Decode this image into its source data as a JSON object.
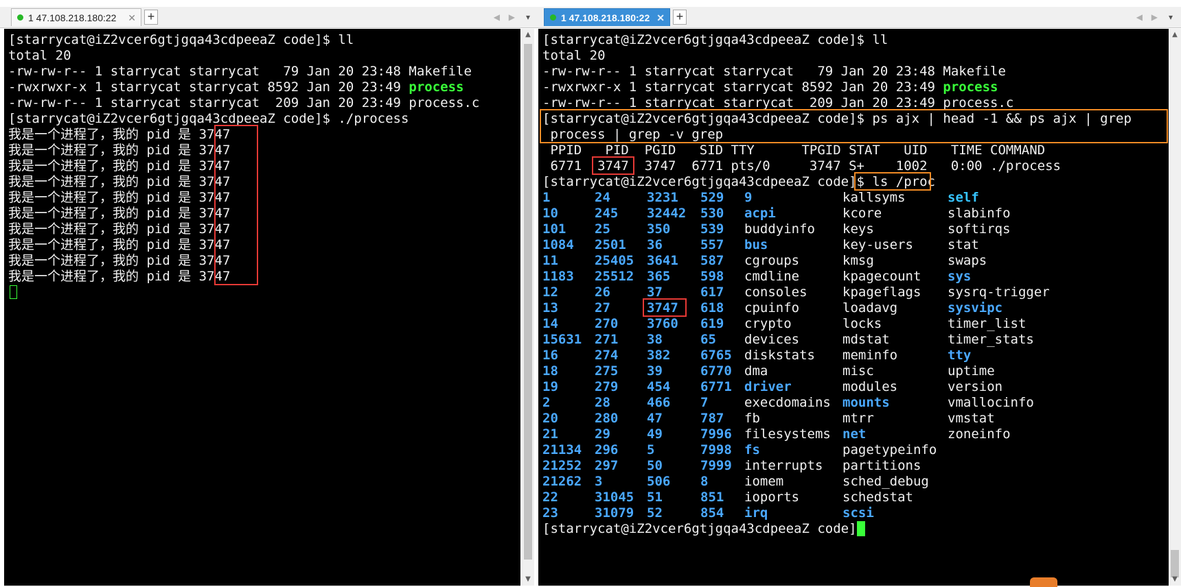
{
  "left": {
    "tab_label": "1 47.108.218.180:22",
    "lines": [
      "[starrycat@iZ2vcer6gtjgqa43cdpeeaZ code]$ ll",
      "total 20",
      "-rw-rw-r-- 1 starrycat starrycat   79 Jan 20 23:48 Makefile",
      "-rwxrwxr-x 1 starrycat starrycat 8592 Jan 20 23:49 ",
      "-rw-rw-r-- 1 starrycat starrycat  209 Jan 20 23:49 process.c",
      "[starrycat@iZ2vcer6gtjgqa43cdpeeaZ code]$ ./process"
    ],
    "exec_name": "process",
    "output_lines": [
      "我是一个进程了，我的 pid 是 3747",
      "我是一个进程了，我的 pid 是 3747",
      "我是一个进程了，我的 pid 是 3747",
      "我是一个进程了，我的 pid 是 3747",
      "我是一个进程了，我的 pid 是 3747",
      "我是一个进程了，我的 pid 是 3747",
      "我是一个进程了，我的 pid 是 3747",
      "我是一个进程了，我的 pid 是 3747",
      "我是一个进程了，我的 pid 是 3747",
      "我是一个进程了，我的 pid 是 3747"
    ]
  },
  "right": {
    "tab_label": "1 47.108.218.180:22",
    "lines": [
      "[starrycat@iZ2vcer6gtjgqa43cdpeeaZ code]$ ll",
      "total 20",
      "-rw-rw-r-- 1 starrycat starrycat   79 Jan 20 23:48 Makefile",
      "-rwxrwxr-x 1 starrycat starrycat 8592 Jan 20 23:49 ",
      "-rw-rw-r-- 1 starrycat starrycat  209 Jan 20 23:49 process.c",
      "[starrycat@iZ2vcer6gtjgqa43cdpeeaZ code]$ ps ajx | head -1 && ps ajx | grep",
      " process | grep -v grep",
      " PPID   PID  PGID   SID TTY      TPGID STAT   UID   TIME COMMAND",
      " 6771  3747  3747  6771 pts/0     3747 S+    1002   0:00 ./process",
      "[starrycat@iZ2vcer6gtjgqa43cdpeeaZ code]$ ls /proc"
    ],
    "exec_name": "process",
    "proc_columns": [
      [
        "1",
        "10",
        "101",
        "1084",
        "11",
        "1183",
        "12",
        "13",
        "14",
        "15631",
        "16",
        "18",
        "19",
        "2",
        "20",
        "21",
        "21134",
        "21252",
        "21262",
        "22",
        "23"
      ],
      [
        "24",
        "245",
        "25",
        "2501",
        "25405",
        "25512",
        "26",
        "27",
        "270",
        "271",
        "274",
        "275",
        "279",
        "28",
        "280",
        "29",
        "296",
        "297",
        "3",
        "31045",
        "31079"
      ],
      [
        "3231",
        "32442",
        "350",
        "36",
        "3641",
        "365",
        "37",
        "3747",
        "3760",
        "38",
        "382",
        "39",
        "454",
        "466",
        "47",
        "49",
        "5",
        "50",
        "506",
        "51",
        "52"
      ],
      [
        "529",
        "530",
        "539",
        "557",
        "587",
        "598",
        "617",
        "618",
        "619",
        "65",
        "6765",
        "6770",
        "6771",
        "7",
        "787",
        "7996",
        "7998",
        "7999",
        "8",
        "851",
        "854"
      ],
      [
        "9",
        "acpi",
        "buddyinfo",
        "bus",
        "cgroups",
        "cmdline",
        "consoles",
        "cpuinfo",
        "crypto",
        "devices",
        "diskstats",
        "dma",
        "driver",
        "execdomains",
        "fb",
        "filesystems",
        "fs",
        "interrupts",
        "iomem",
        "ioports",
        "irq"
      ],
      [
        "kallsyms",
        "kcore",
        "keys",
        "key-users",
        "kmsg",
        "kpagecount",
        "kpageflags",
        "loadavg",
        "locks",
        "mdstat",
        "meminfo",
        "misc",
        "modules",
        "mounts",
        "mtrr",
        "net",
        "pagetypeinfo",
        "partitions",
        "sched_debug",
        "schedstat",
        "scsi"
      ],
      [
        "self",
        "slabinfo",
        "softirqs",
        "stat",
        "swaps",
        "sys",
        "sysrq-trigger",
        "sysvipc",
        "timer_list",
        "timer_stats",
        "tty",
        "uptime",
        "version",
        "vmallocinfo",
        "vmstat",
        "zoneinfo"
      ]
    ],
    "final_prompt": "[starrycat@iZ2vcer6gtjgqa43cdpeeaZ code]$ "
  },
  "colors": {
    "terminal_bg": "#000000",
    "terminal_fg": "#f0f0f0",
    "exec_green": "#39ff39",
    "dir_blue": "#4aa8ff",
    "link_cyan": "#36c4ff",
    "highlight_red": "#e53935",
    "highlight_orange": "#f08a24",
    "active_tab": "#3a8fd8"
  }
}
